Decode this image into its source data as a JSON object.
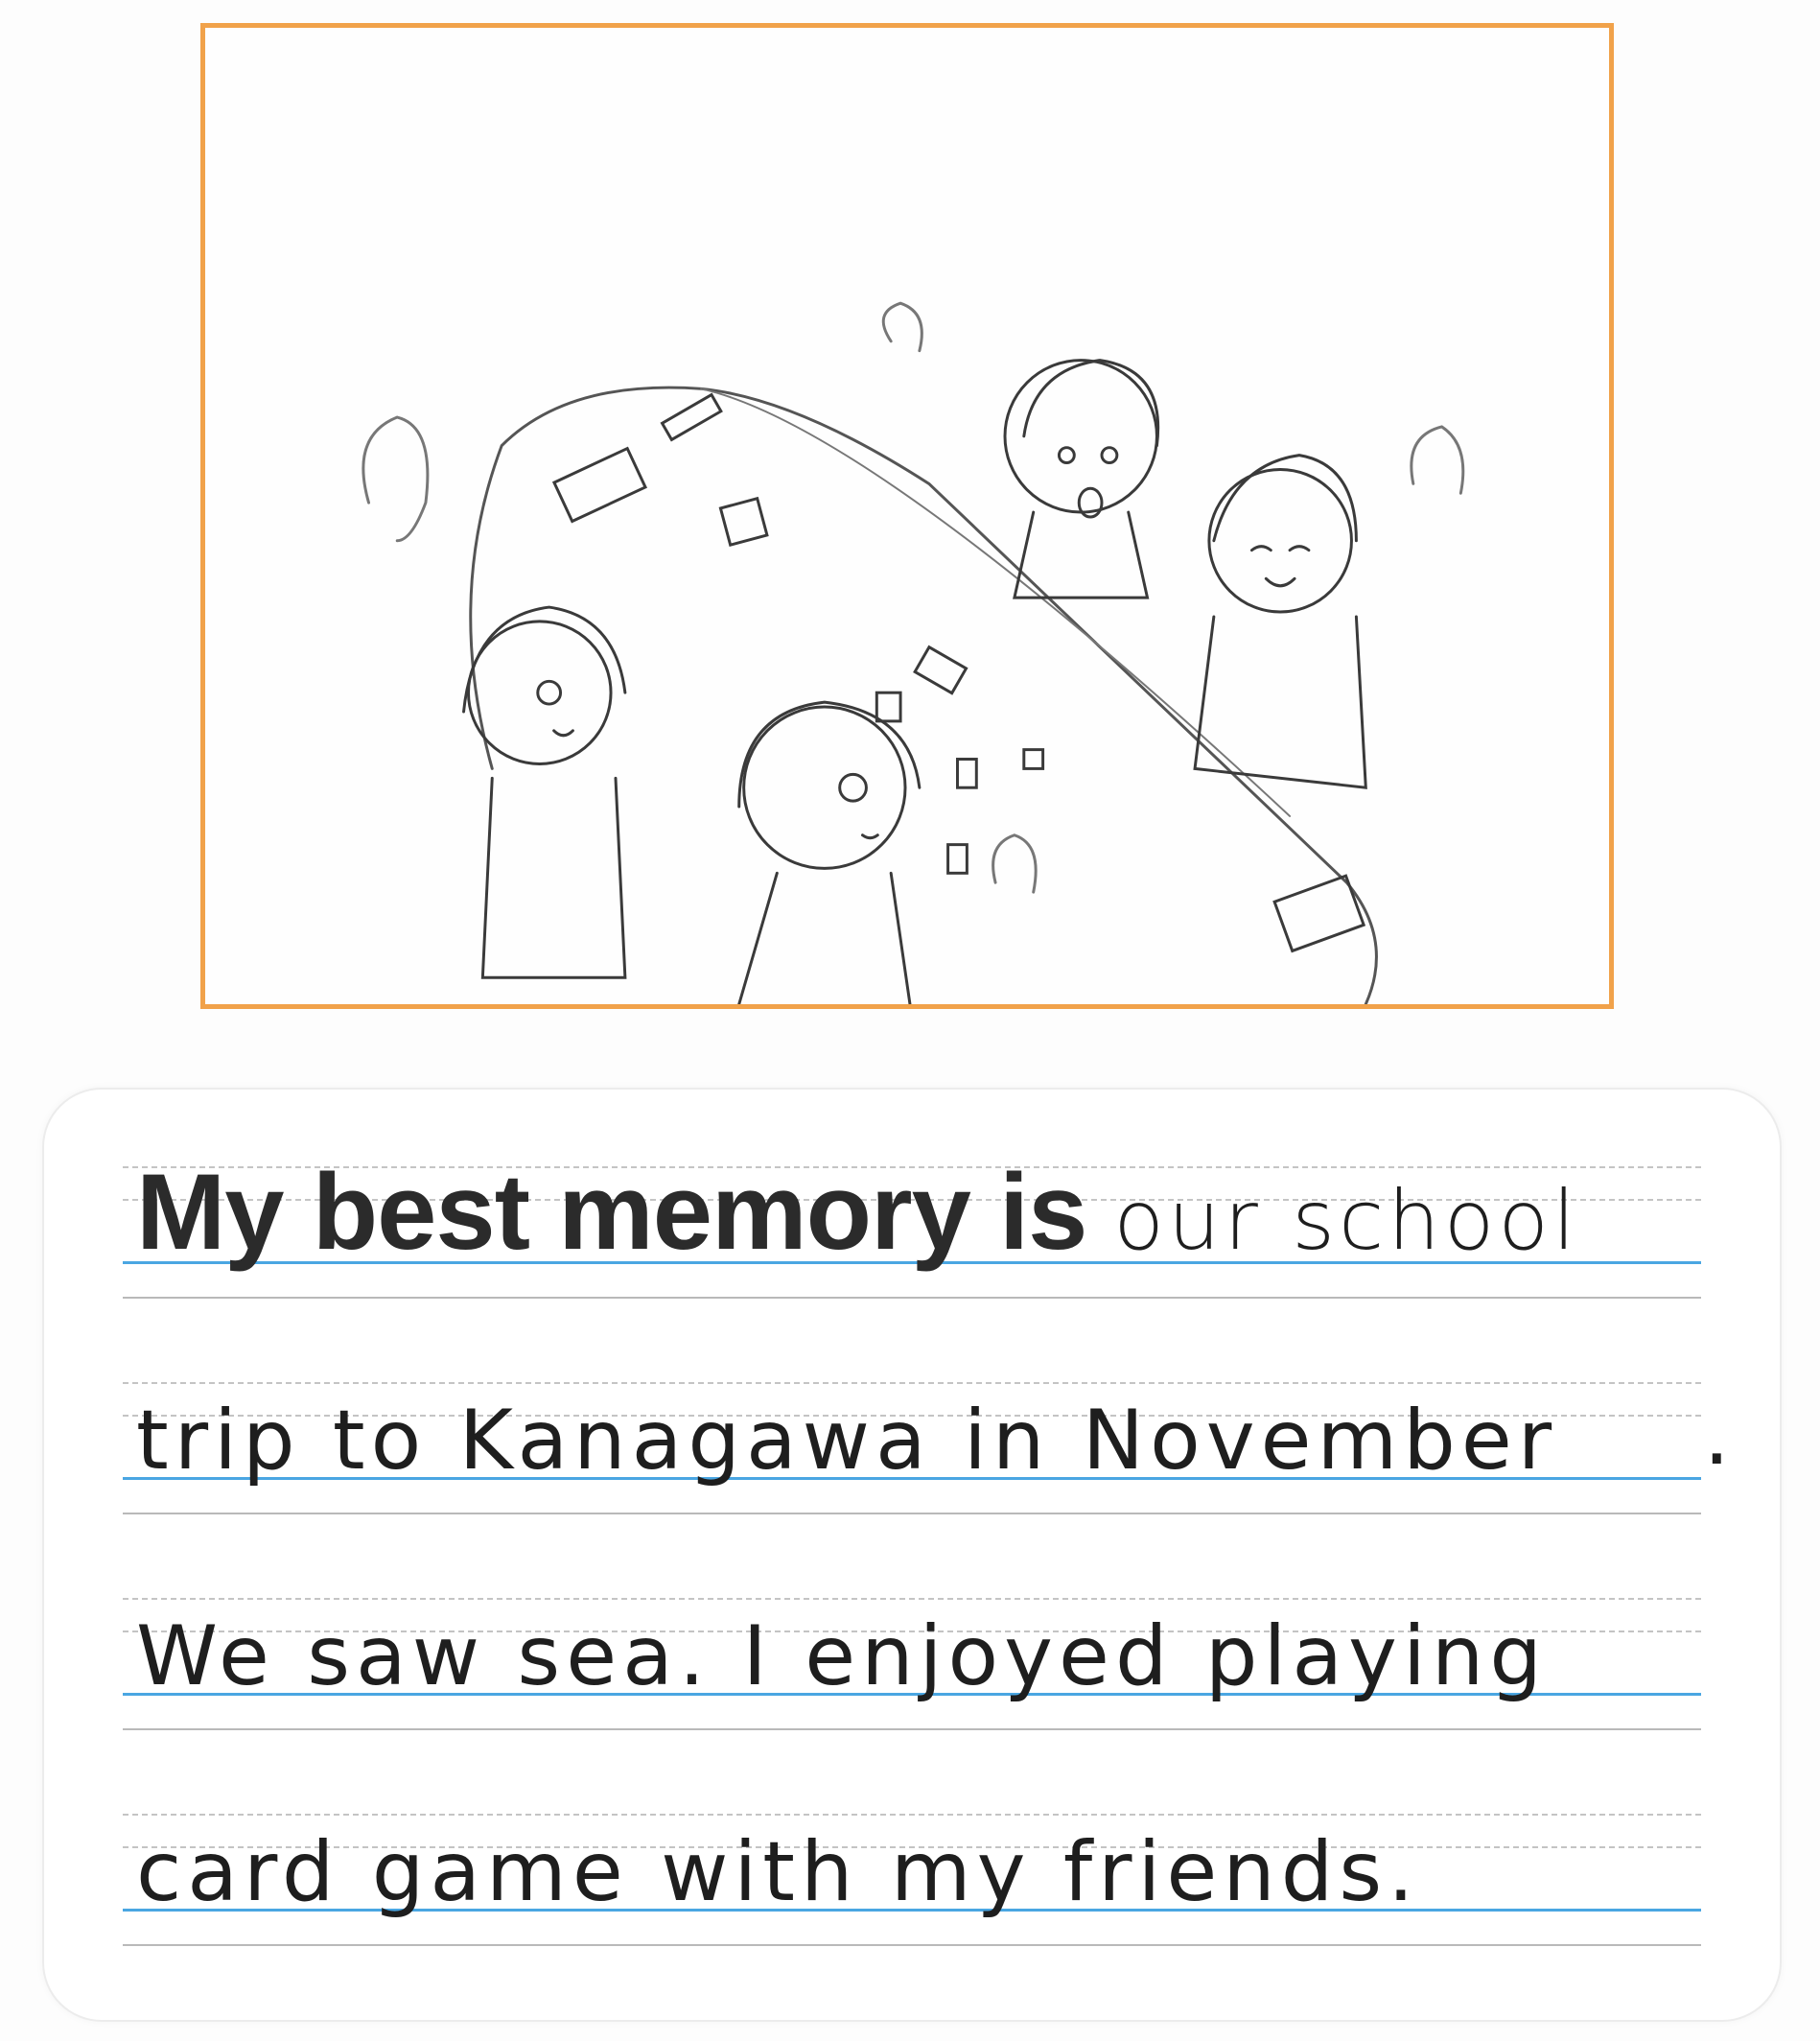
{
  "illustration": {
    "description_icon": "classroom-card-game-drawing"
  },
  "writing": {
    "printed_prompt": "My best memory is",
    "line1_handwritten": "our school",
    "line2_handwritten": "trip to Kanagawa in November",
    "line2_period": ".",
    "line3_handwritten": "We saw sea. I enjoyed playing",
    "line4_handwritten": "card game with my friends."
  },
  "colors": {
    "frame": "#f1a24a",
    "baseline": "#4aa6e2"
  }
}
